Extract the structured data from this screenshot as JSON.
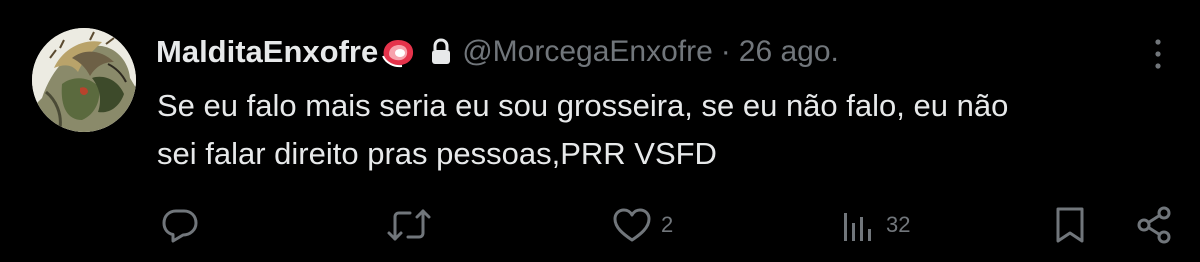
{
  "tweet": {
    "author": {
      "display_name": "MalditaEnxofre",
      "name_emoji": "meat-emoji",
      "protected_icon": "lock-icon",
      "handle": "@MorcegaEnxofre",
      "separator": "·",
      "date": "26 ago."
    },
    "text_line_1": "Se eu falo mais seria eu sou grosseira, se eu não falo, eu não",
    "text_line_2": "sei falar direito pras pessoas,PRR VSFD",
    "actions": {
      "reply": {
        "icon": "reply-icon",
        "count": ""
      },
      "retweet": {
        "icon": "retweet-icon",
        "count": ""
      },
      "like": {
        "icon": "heart-icon",
        "count": "2"
      },
      "views": {
        "icon": "views-icon",
        "count": "32"
      },
      "bookmark": {
        "icon": "bookmark-icon"
      },
      "share": {
        "icon": "share-icon"
      }
    },
    "more_icon": "more-vertical-icon"
  },
  "colors": {
    "background": "#000000",
    "primary_text": "#e7e9ea",
    "secondary_text": "#71767b",
    "icon": "#71767b"
  }
}
